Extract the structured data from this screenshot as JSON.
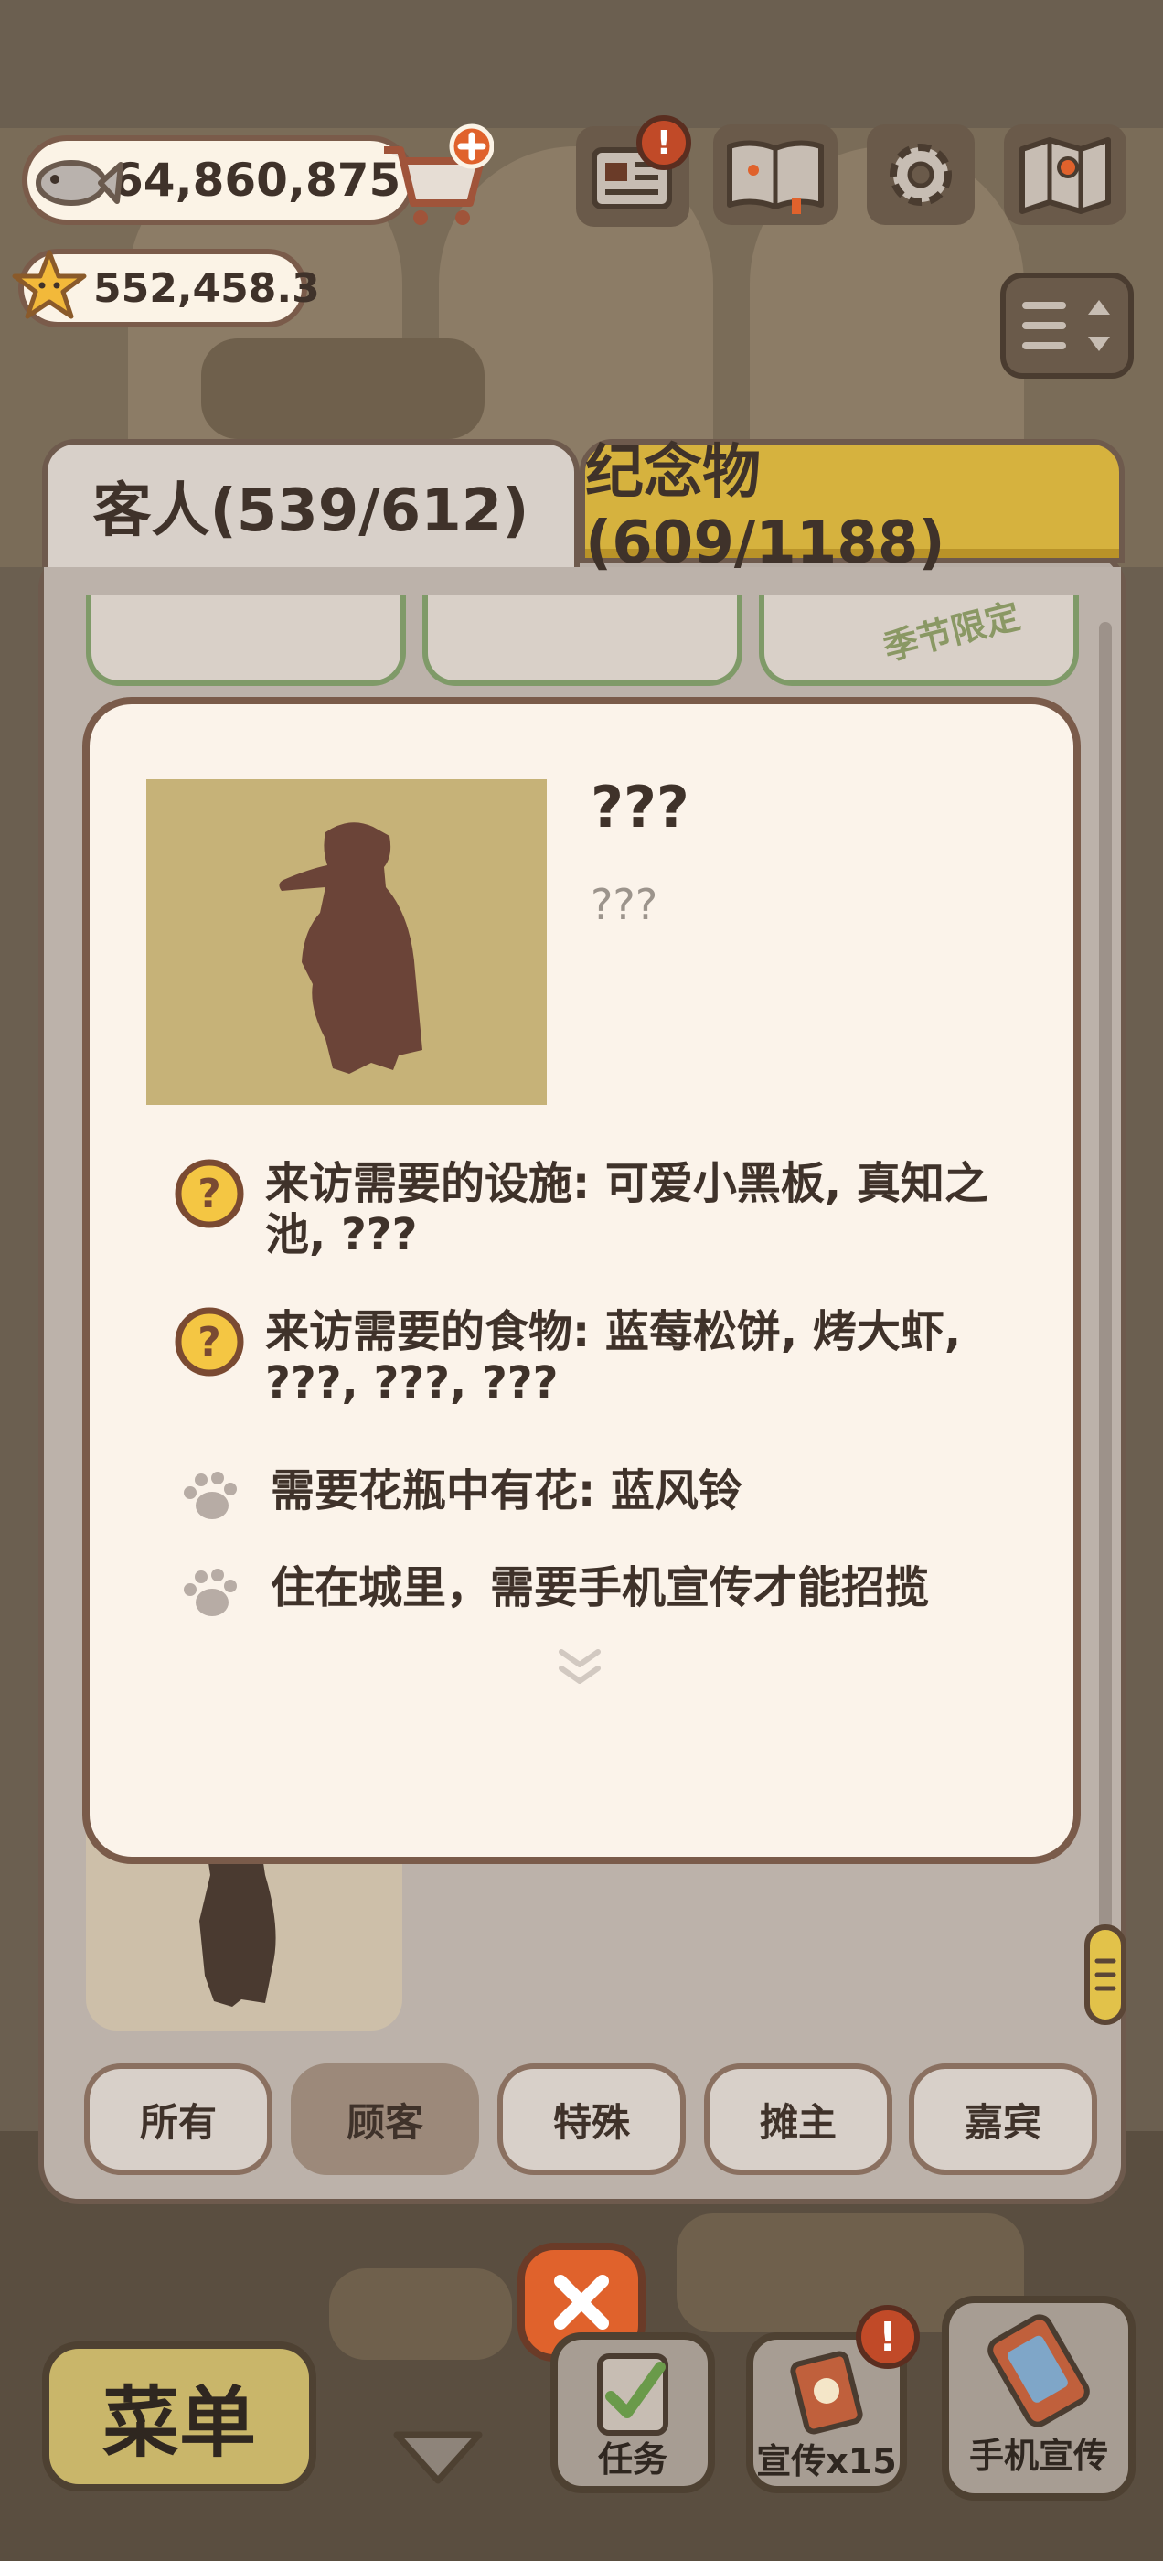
{
  "currency": {
    "fish": "64,860,875",
    "stars": "552,458.3"
  },
  "tabs": {
    "guests": "客人(539/612)",
    "souvenirs": "纪念物(609/1188)"
  },
  "season_tag": "季节限定",
  "detail": {
    "name": "???",
    "description": "???",
    "requirements": [
      {
        "icon": "question-icon",
        "text": "来访需要的设施: 可爱小黑板, 真知之池, ???"
      },
      {
        "icon": "question-icon",
        "text": "来访需要的食物: 蓝莓松饼, 烤大虾, ???, ???, ???"
      },
      {
        "icon": "paw-icon",
        "text": "需要花瓶中有花: 蓝风铃"
      },
      {
        "icon": "paw-icon",
        "text": "住在城里，需要手机宣传才能招揽"
      }
    ]
  },
  "filters": {
    "all": "所有",
    "customer": "顾客",
    "special": "特殊",
    "vendor": "摊主",
    "guest": "嘉宾",
    "active": "顾客"
  },
  "bottom_bar": {
    "menu": "菜单",
    "tasks": "任务",
    "promote": "宣传x15",
    "phone_promote": "手机宣传",
    "badge": "!"
  },
  "colors": {
    "accent_gold": "#d6b23e",
    "close_orange": "#e0622c",
    "popup_bg": "#fbf3ea",
    "border_brown": "#7a5b4a"
  }
}
